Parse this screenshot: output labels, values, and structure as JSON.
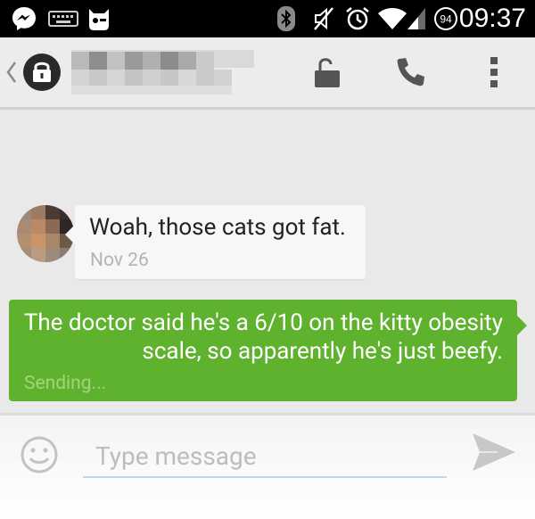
{
  "status_bar": {
    "time": "09:37",
    "notification_badge": "94",
    "icons": [
      "messenger-icon",
      "keyboard-icon",
      "cyanogen-mod-icon",
      "bluetooth-icon",
      "mute-icon",
      "alarm-icon",
      "wifi-icon",
      "signal-icon",
      "notification-count-icon"
    ]
  },
  "action_bar": {
    "contact_name_pixelated": true,
    "actions": [
      "unlock-icon",
      "phone-call-icon",
      "overflow-menu-icon"
    ]
  },
  "conversation": {
    "incoming": {
      "text": "Woah, those cats got fat.",
      "timestamp": "Nov 26"
    },
    "outgoing": {
      "text": "The doctor said he's a 6/10 on the kitty obesity scale, so apparently he's just beefy.",
      "status": "Sending..."
    }
  },
  "composer": {
    "placeholder": "Type message",
    "value": ""
  },
  "colors": {
    "outgoing_bubble": "#5fb22d",
    "incoming_bubble": "#f7f7f7",
    "background": "#e9e9e9",
    "status_bar": "#000000"
  }
}
